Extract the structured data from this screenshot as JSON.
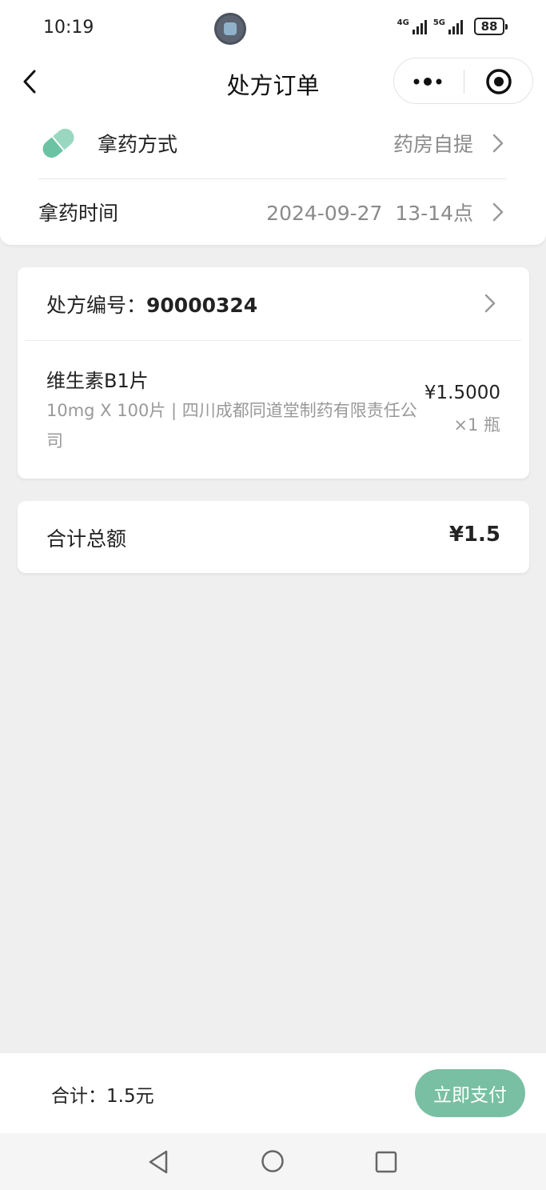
{
  "status_bar": {
    "time": "10:19",
    "network_1": "4G",
    "network_2": "5G",
    "battery": "88"
  },
  "nav": {
    "title": "处方订单"
  },
  "pickup": {
    "method_label": "拿药方式",
    "method_value": "药房自提",
    "time_label": "拿药时间",
    "time_value": "2024-09-27  13-14点"
  },
  "prescription": {
    "number_label": "处方编号：",
    "number": "90000324",
    "items": [
      {
        "name": "维生素B1片",
        "desc": "10mg X 100片 | 四川成都同道堂制药有限责任公司",
        "price": "¥1.5000",
        "qty": "×1 瓶"
      }
    ]
  },
  "total": {
    "label": "合计总额",
    "value": "¥1.5"
  },
  "pay_bar": {
    "summary": "合计：1.5元",
    "button_label": "立即支付"
  },
  "colors": {
    "accent": "#79bfa3",
    "pill": "#6cc3a4",
    "background": "#efefef"
  },
  "icons": {
    "back": "chevron-left-icon",
    "more": "more-dots-icon",
    "target": "target-icon",
    "pill": "pill-icon",
    "chevron": "chevron-right-icon"
  }
}
